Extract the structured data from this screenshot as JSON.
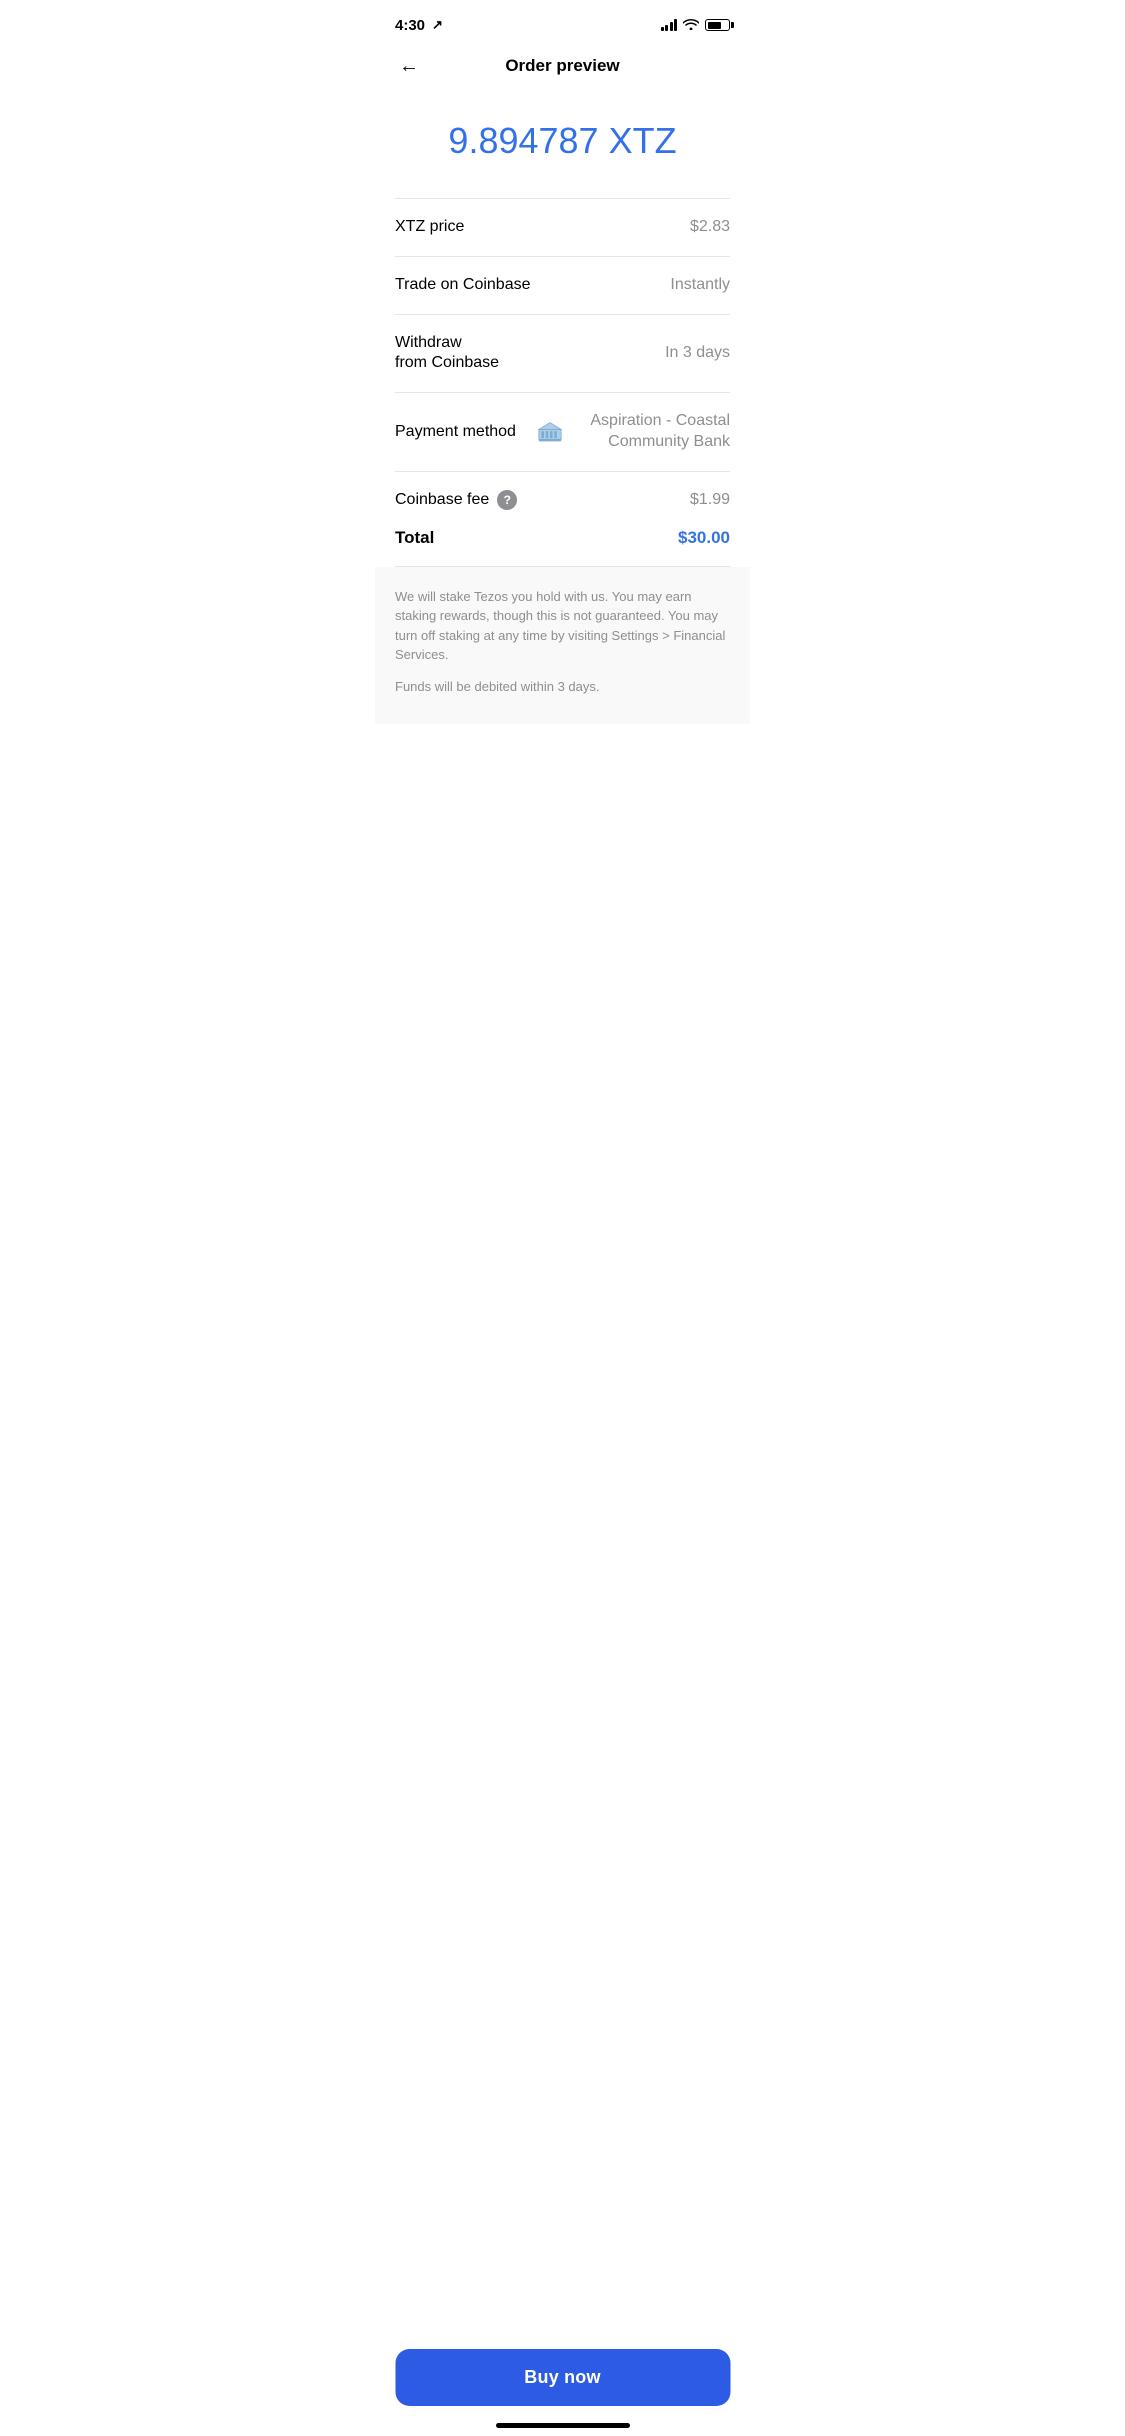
{
  "statusBar": {
    "time": "4:30",
    "navArrow": "↗"
  },
  "header": {
    "backLabel": "←",
    "title": "Order preview"
  },
  "amount": {
    "value": "9.894787 XTZ",
    "color": "#3471e8"
  },
  "details": [
    {
      "label": "XTZ price",
      "value": "$2.83",
      "type": "normal"
    },
    {
      "label": "Trade on Coinbase",
      "value": "Instantly",
      "type": "normal"
    },
    {
      "label": "Withdraw\nfrom Coinbase",
      "value": "In 3 days",
      "type": "normal"
    }
  ],
  "paymentMethod": {
    "label": "Payment method",
    "bankName": "Aspiration - Coastal Community Bank"
  },
  "fee": {
    "label": "Coinbase fee",
    "questionMark": "?",
    "value": "$1.99"
  },
  "total": {
    "label": "Total",
    "value": "$30.00"
  },
  "disclaimer": {
    "stakingText": "We will stake Tezos you hold with us. You may earn staking rewards, though this is not guaranteed. You may turn off staking at any time by visiting Settings > Financial Services.",
    "fundsText": "Funds will be debited within 3 days."
  },
  "buyButton": {
    "label": "Buy now"
  }
}
